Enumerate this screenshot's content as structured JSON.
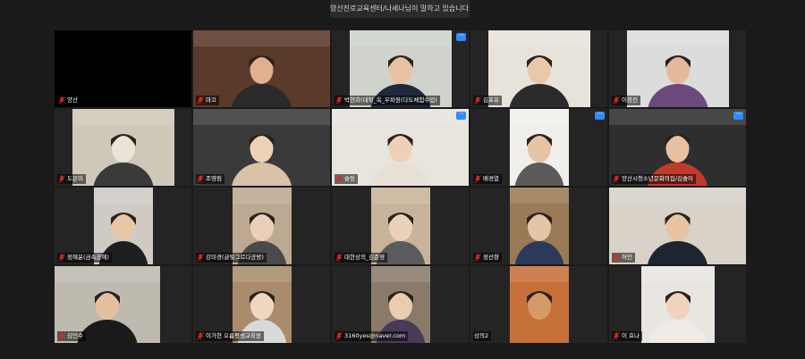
{
  "banner": {
    "text": "양산진로교육센터/나세나님이 말하고 있습니다..."
  },
  "icons": {
    "muted": "mic-muted-icon",
    "more": "more-options-icon"
  },
  "colors": {
    "accent": "#2d8cff",
    "muted_mic": "#e02828"
  },
  "participants": [
    {
      "name": "양산",
      "muted": true,
      "video": "off"
    },
    {
      "name": "마끄",
      "muted": true,
      "video": "on"
    },
    {
      "name": "박현희(대학_옥_우파원(다도체험수업)",
      "muted": true,
      "video": "on",
      "more": true
    },
    {
      "name": "김포유",
      "muted": true,
      "video": "on"
    },
    {
      "name": "이창진",
      "muted": true,
      "video": "on"
    },
    {
      "name": "도은미",
      "muted": true,
      "video": "on"
    },
    {
      "name": "조영림",
      "muted": true,
      "video": "on"
    },
    {
      "name": "슬링",
      "muted": true,
      "video": "on",
      "more": true
    },
    {
      "name": "배경열",
      "muted": true,
      "video": "on",
      "more": true
    },
    {
      "name": "양산시청소년문화의집/김솔이",
      "muted": true,
      "video": "on",
      "more": true
    },
    {
      "name": "정혜윤(금속공예)",
      "muted": true,
      "video": "on"
    },
    {
      "name": "강미경(글빛그르다공방)",
      "muted": true,
      "video": "on"
    },
    {
      "name": "대한상의_김준영",
      "muted": true,
      "video": "on"
    },
    {
      "name": "정선향",
      "muted": true,
      "video": "on"
    },
    {
      "name": "허민",
      "muted": true,
      "video": "on"
    },
    {
      "name": "김민수",
      "muted": true,
      "video": "on"
    },
    {
      "name": "이가현 오름평생교육원",
      "muted": true,
      "video": "on"
    },
    {
      "name": "3160yes@naver.com",
      "muted": true,
      "video": "on"
    },
    {
      "name": "상의2",
      "muted": false,
      "video": "on"
    },
    {
      "name": "이 효나",
      "muted": true,
      "video": "on"
    }
  ]
}
